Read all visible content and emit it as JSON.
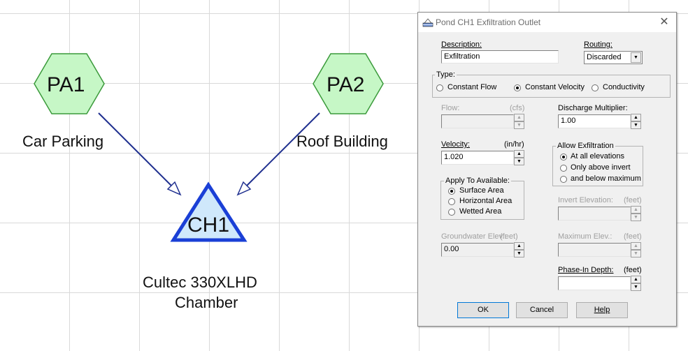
{
  "diagram": {
    "nodes": [
      {
        "id": "PA1",
        "label": "PA1",
        "caption": "Car Parking"
      },
      {
        "id": "PA2",
        "label": "PA2",
        "caption": "Roof Building"
      },
      {
        "id": "CH1",
        "label": "CH1",
        "caption_line1": "Cultec 330XLHD",
        "caption_line2": "Chamber"
      }
    ],
    "colors": {
      "subcatchment_fill": "#c6f7c6",
      "subcatchment_stroke": "#3a9a3a",
      "pond_fill": "#cfe8fb",
      "pond_stroke": "#1a3fd6",
      "link": "#1f2f8f"
    }
  },
  "dialog": {
    "title": "Pond CH1 Exfiltration Outlet",
    "close_glyph": "✕",
    "description_label": "Description:",
    "description_value": "Exfiltration",
    "routing_label": "Routing:",
    "routing_value": "Discarded",
    "type_group": "Type:",
    "type_options": [
      "Constant Flow",
      "Constant Velocity",
      "Conductivity"
    ],
    "type_selected": "Constant Velocity",
    "flow_label": "Flow:",
    "flow_unit": "(cfs)",
    "flow_value": "",
    "discharge_label": "Discharge Multiplier:",
    "discharge_value": "1.00",
    "velocity_label": "Velocity:",
    "velocity_unit": "(in/hr)",
    "velocity_value": "1.020",
    "allow_group": "Allow Exfiltration",
    "allow_options": [
      "At all elevations",
      "Only above invert",
      "and below maximum"
    ],
    "allow_selected": "At all elevations",
    "apply_group": "Apply To Available:",
    "apply_options": [
      "Surface Area",
      "Horizontal Area",
      "Wetted Area"
    ],
    "apply_selected": "Surface Area",
    "invert_label": "Invert Elevation:",
    "invert_unit": "(feet)",
    "invert_value": "",
    "groundwater_label": "Groundwater Elev.:",
    "groundwater_unit": "(feet)",
    "groundwater_value": "0.00",
    "maximum_label": "Maximum Elev.:",
    "maximum_unit": "(feet)",
    "maximum_value": "",
    "phasein_label": "Phase-In Depth:",
    "phasein_unit": "(feet)",
    "phasein_value": "",
    "ok_label": "OK",
    "cancel_label": "Cancel",
    "help_label": "Help"
  }
}
